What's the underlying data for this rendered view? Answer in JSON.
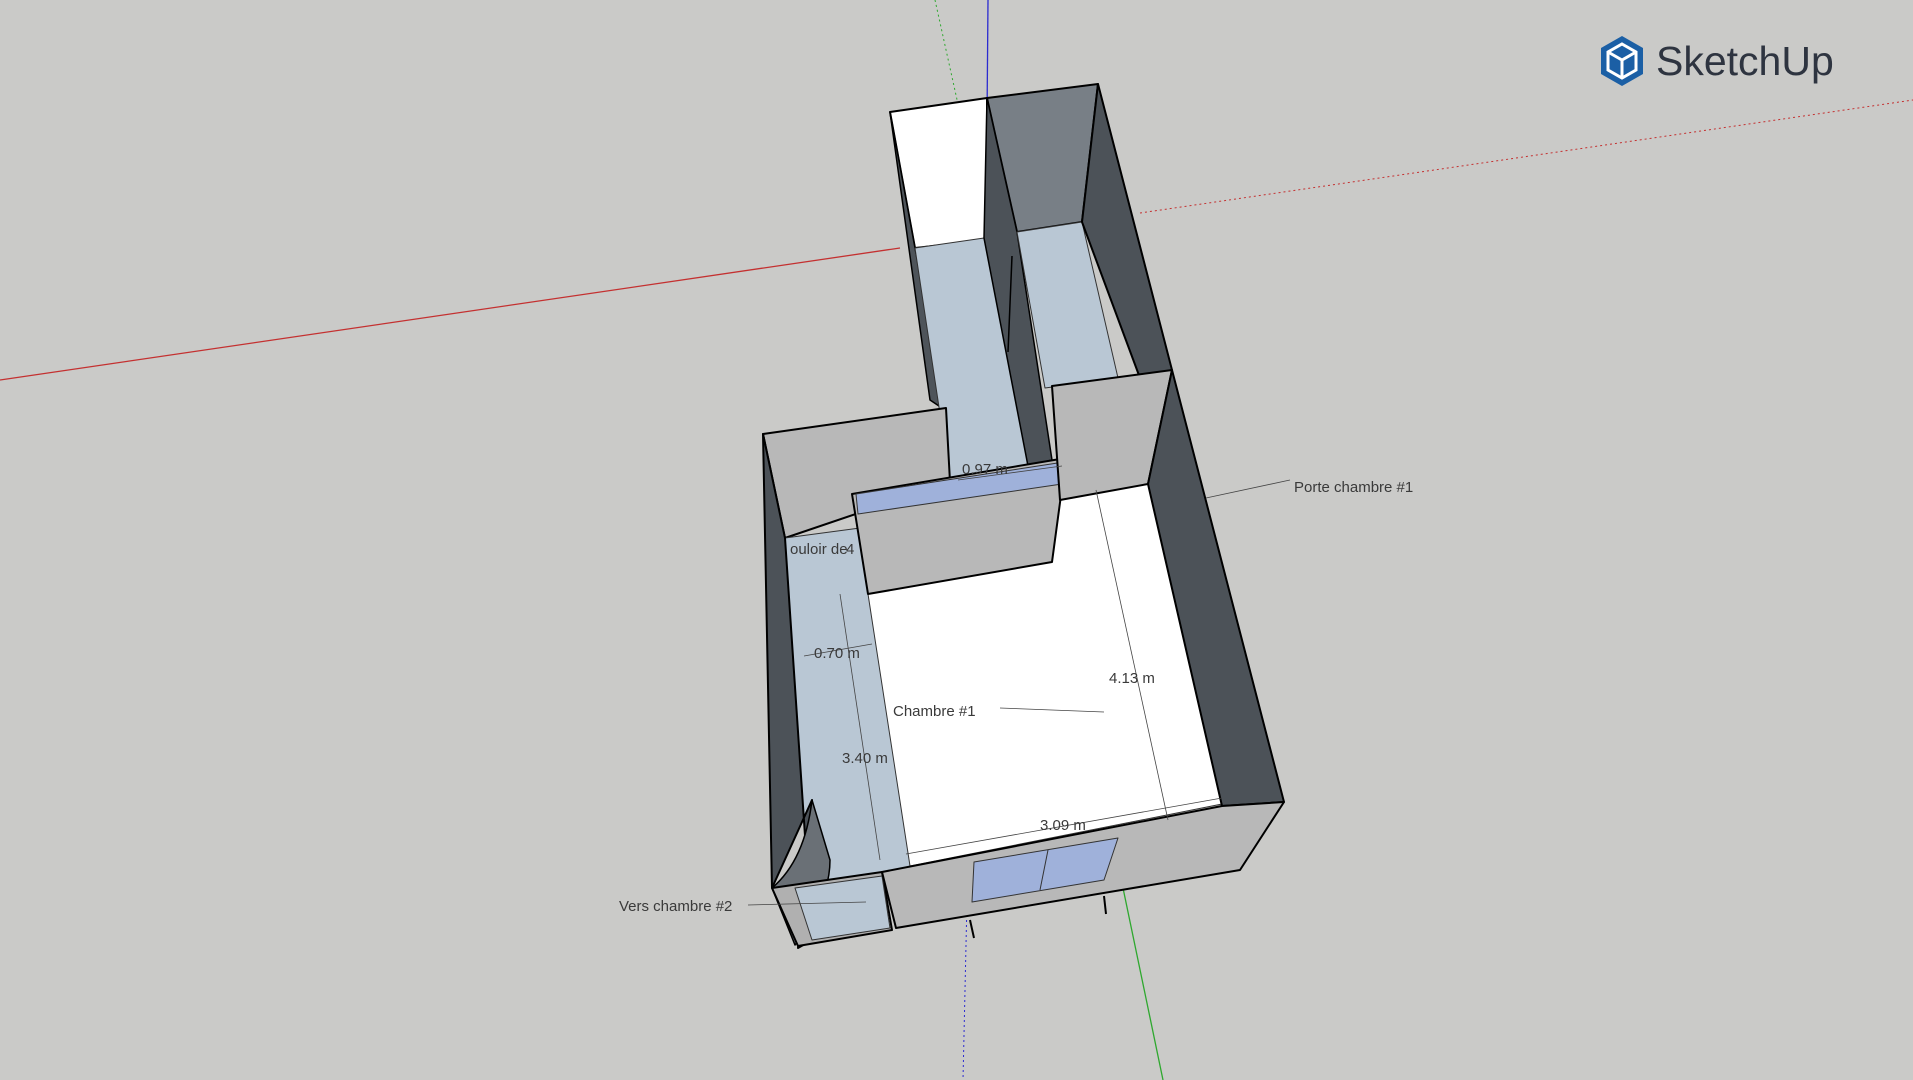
{
  "app": {
    "logo_text": "SketchUp",
    "logo_icon": "sketchup-cube-icon",
    "brand_color": "#1b5fa5"
  },
  "labels": {
    "porte_chambre_1": "Porte chambre #1",
    "chambre_1": "Chambre #1",
    "vers_chambre_2": "Vers chambre #2",
    "couloir": "ouloir de",
    "couloir_suffix": "4"
  },
  "dimensions": {
    "d_097": "0.97 m",
    "d_070": "0.70 m",
    "d_340": "3.40 m",
    "d_413": "4.13 m",
    "d_309": "3.09 m"
  },
  "colors": {
    "background": "#cacac8",
    "x_axis": "#c43030",
    "y_axis": "#2ea82e",
    "z_axis": "#2b2bd0",
    "floor_white": "#ffffff",
    "floor_blue": "#b9c7d4",
    "wall_light": "#b8b8b8",
    "wall_dark": "#4c5258",
    "glass": "#9fb1da"
  }
}
